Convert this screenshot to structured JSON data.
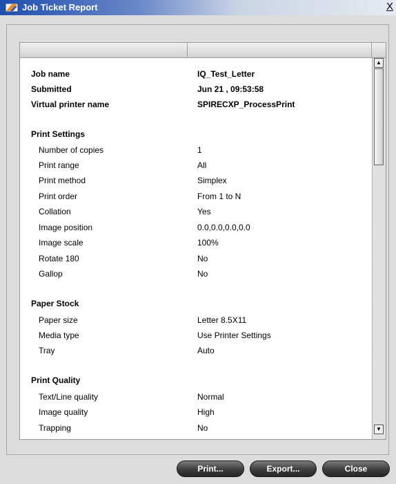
{
  "window": {
    "title": "Job Ticket Report",
    "close_glyph": "X",
    "icon": "app-icon"
  },
  "report": {
    "header": {
      "job_name_label": "Job name",
      "job_name": "IQ_Test_Letter",
      "submitted_label": "Submitted",
      "submitted": "Jun 21 , 09:53:58",
      "vp_label": "Virtual printer name",
      "vp": "SPIRECXP_ProcessPrint"
    },
    "print_settings": {
      "title": "Print Settings",
      "rows": [
        {
          "label": "Number of copies",
          "value": "1"
        },
        {
          "label": "Print range",
          "value": "All"
        },
        {
          "label": "Print method",
          "value": "Simplex"
        },
        {
          "label": "Print order",
          "value": "From 1 to N"
        },
        {
          "label": "Collation",
          "value": "Yes"
        },
        {
          "label": "Image position",
          "value": "0.0,0.0,0.0,0.0"
        },
        {
          "label": "Image scale",
          "value": "100%"
        },
        {
          "label": "Rotate 180",
          "value": "No"
        },
        {
          "label": "Gallop",
          "value": "No"
        }
      ]
    },
    "paper_stock": {
      "title": "Paper Stock",
      "rows": [
        {
          "label": "Paper size",
          "value": "Letter 8.5X11"
        },
        {
          "label": "Media type",
          "value": "Use Printer Settings"
        },
        {
          "label": "Tray",
          "value": "Auto"
        }
      ]
    },
    "print_quality": {
      "title": "Print Quality",
      "rows": [
        {
          "label": "Text/Line quality",
          "value": "Normal"
        },
        {
          "label": "Image quality",
          "value": "High"
        },
        {
          "label": "Trapping",
          "value": "No"
        }
      ]
    }
  },
  "buttons": {
    "print": "Print...",
    "export": "Export...",
    "close": "Close"
  }
}
